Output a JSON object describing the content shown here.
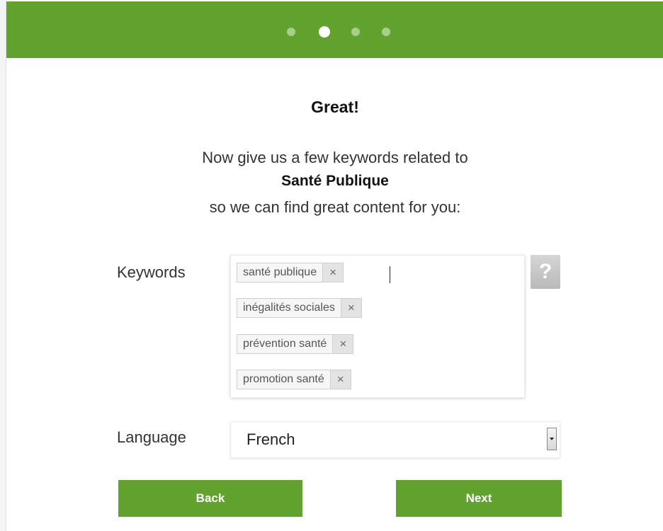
{
  "progress": {
    "steps": 4,
    "current_step": 2
  },
  "heading": "Great!",
  "intro": {
    "line1": "Now give us a few keywords related to",
    "topic": "Santé Publique",
    "line3": "so we can find great content for you:"
  },
  "keywords": {
    "label": "Keywords",
    "tags": [
      {
        "label": "santé publique",
        "remove": "×"
      },
      {
        "label": "inégalités sociales",
        "remove": "×"
      },
      {
        "label": "prévention santé",
        "remove": "×"
      },
      {
        "label": "promotion santé",
        "remove": "×"
      }
    ],
    "help": "?"
  },
  "language": {
    "label": "Language",
    "selected": "French"
  },
  "buttons": {
    "back": "Back",
    "next": "Next"
  },
  "colors": {
    "accent": "#62a22e",
    "dot_inactive": "#a7cf8a",
    "dot_active": "#ffffff"
  },
  "icons": {
    "remove": "close-icon",
    "help": "question-mark-icon",
    "dropdown": "chevron-down-icon"
  }
}
